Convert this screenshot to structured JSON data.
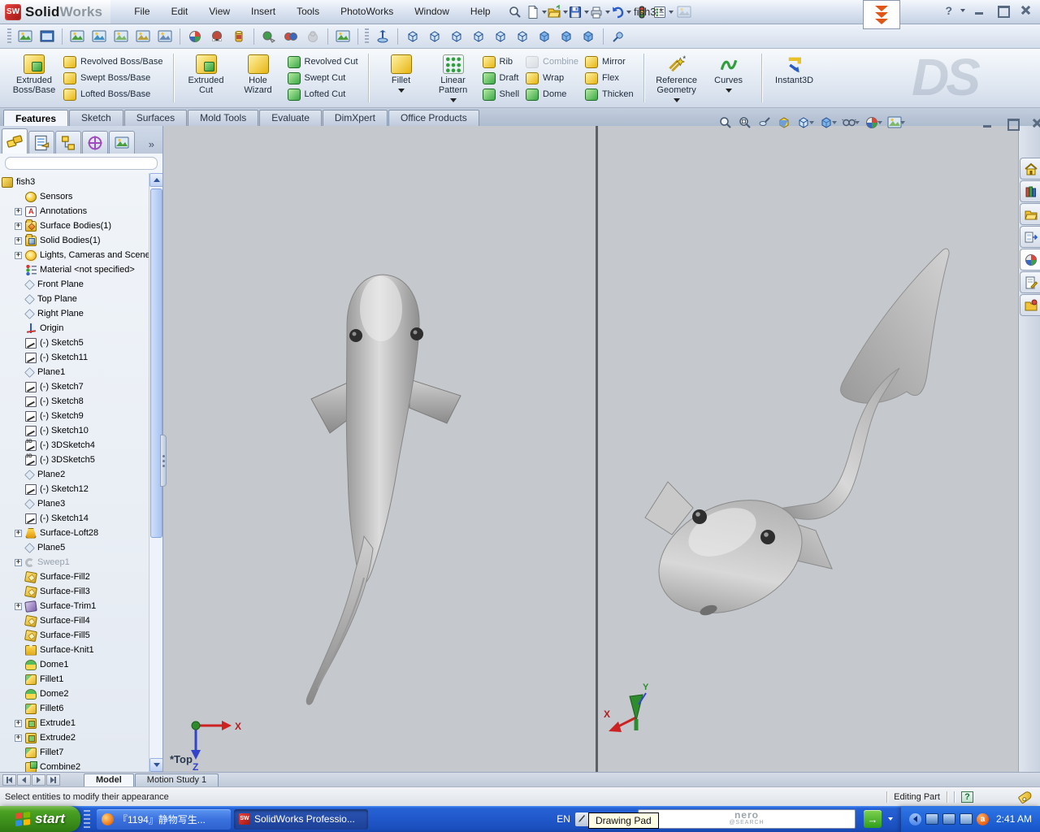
{
  "window": {
    "app_bold": "Solid",
    "app_light": "Works",
    "logo_glyph": "SW",
    "doc_title": "fish3 *",
    "help_glyph": "?"
  },
  "menu": {
    "items": [
      "File",
      "Edit",
      "View",
      "Insert",
      "Tools",
      "PhotoWorks",
      "Window",
      "Help"
    ]
  },
  "toolbar_top": {
    "buttons": [
      {
        "name": "search-assistant"
      },
      {
        "name": "new-document",
        "arrow": true
      },
      {
        "name": "open-document",
        "arrow": true
      },
      {
        "name": "save-document",
        "arrow": true
      },
      {
        "name": "print",
        "arrow": true
      },
      {
        "name": "undo",
        "arrow": true
      },
      {
        "name": "rebuild"
      },
      {
        "name": "options",
        "arrow": true
      },
      {
        "name": "image-disabled",
        "disabled": true
      }
    ]
  },
  "toolbar_photoworks": {
    "buttons": [
      {
        "name": "render"
      },
      {
        "name": "render-window"
      },
      {
        "sep": true
      },
      {
        "name": "render-region"
      },
      {
        "name": "render-selection"
      },
      {
        "name": "render-last"
      },
      {
        "name": "render-to-file"
      },
      {
        "name": "schedule-render"
      },
      {
        "sep": true
      },
      {
        "name": "appearance-sphere"
      },
      {
        "name": "scene-sphere"
      },
      {
        "name": "decal"
      },
      {
        "sep": true
      },
      {
        "name": "copy-appearance"
      },
      {
        "name": "paste-appearance"
      },
      {
        "name": "appearance-locked",
        "disabled": true
      },
      {
        "sep": true
      },
      {
        "name": "scene-editor"
      }
    ]
  },
  "toolbar_views": {
    "buttons": [
      {
        "name": "normal-to"
      },
      {
        "sep": true
      },
      {
        "name": "view-front",
        "wire": true
      },
      {
        "name": "view-back",
        "wire": true
      },
      {
        "name": "view-left",
        "wire": true
      },
      {
        "name": "view-right",
        "wire": true
      },
      {
        "name": "view-top",
        "wire": true
      },
      {
        "name": "view-bottom",
        "wire": true
      },
      {
        "name": "view-isometric"
      },
      {
        "name": "view-trimetric"
      },
      {
        "name": "view-dimetric"
      },
      {
        "sep": true
      },
      {
        "name": "probe"
      }
    ]
  },
  "ribbon": {
    "groups": [
      {
        "cells": [
          {
            "kind": "large",
            "label": "Extruded\nBoss/Base",
            "icon": "extruded-boss",
            "tone": "yg"
          },
          {
            "kind": "stack",
            "items": [
              {
                "label": "Revolved Boss/Base",
                "icon": "revolved-boss",
                "tone": "y"
              },
              {
                "label": "Swept Boss/Base",
                "icon": "swept-boss",
                "tone": "y"
              },
              {
                "label": "Lofted Boss/Base",
                "icon": "lofted-boss",
                "tone": "y"
              }
            ]
          }
        ]
      },
      {
        "cells": [
          {
            "kind": "large",
            "label": "Extruded\nCut",
            "icon": "extruded-cut",
            "tone": "yg"
          },
          {
            "kind": "large",
            "label": "Hole\nWizard",
            "icon": "hole-wizard",
            "tone": "y"
          },
          {
            "kind": "stack",
            "items": [
              {
                "label": "Revolved Cut",
                "icon": "revolved-cut",
                "tone": "g"
              },
              {
                "label": "Swept Cut",
                "icon": "swept-cut",
                "tone": "g"
              },
              {
                "label": "Lofted Cut",
                "icon": "lofted-cut",
                "tone": "g"
              }
            ]
          }
        ]
      },
      {
        "cells": [
          {
            "kind": "large",
            "label": "Fillet",
            "icon": "fillet",
            "tone": "y",
            "arrow": true
          },
          {
            "kind": "large",
            "label": "Linear\nPattern",
            "icon": "linear-pattern",
            "tone": "dots",
            "arrow": true
          },
          {
            "kind": "stack",
            "items": [
              {
                "label": "Rib",
                "icon": "rib",
                "tone": "y"
              },
              {
                "label": "Draft",
                "icon": "draft",
                "tone": "g"
              },
              {
                "label": "Shell",
                "icon": "shell",
                "tone": "g"
              }
            ]
          },
          {
            "kind": "stack",
            "items": [
              {
                "label": "Combine",
                "icon": "combine",
                "tone": "gray",
                "disabled": true
              },
              {
                "label": "Wrap",
                "icon": "wrap",
                "tone": "y"
              },
              {
                "label": "Dome",
                "icon": "dome",
                "tone": "g"
              }
            ]
          },
          {
            "kind": "stack",
            "items": [
              {
                "label": "Mirror",
                "icon": "mirror",
                "tone": "y"
              },
              {
                "label": "Flex",
                "icon": "flex",
                "tone": "y"
              },
              {
                "label": "Thicken",
                "icon": "thicken",
                "tone": "g"
              }
            ]
          }
        ]
      },
      {
        "cells": [
          {
            "kind": "large",
            "label": "Reference\nGeometry",
            "icon": "reference-geometry",
            "tone": "y",
            "arrow": true
          },
          {
            "kind": "large",
            "label": "Curves",
            "icon": "curves",
            "tone": "curves",
            "arrow": true
          }
        ]
      },
      {
        "cells": [
          {
            "kind": "large",
            "label": "Instant3D",
            "icon": "instant3d",
            "tone": "i3d"
          }
        ]
      }
    ],
    "watermark": "DS"
  },
  "cmd_tabs": {
    "items": [
      {
        "label": "Features",
        "active": true
      },
      {
        "label": "Sketch"
      },
      {
        "label": "Surfaces"
      },
      {
        "label": "Mold Tools"
      },
      {
        "label": "Evaluate"
      },
      {
        "label": "DimXpert"
      },
      {
        "label": "Office Products"
      }
    ]
  },
  "panel": {
    "tabs": [
      "feature-manager-tree",
      "property-manager",
      "configuration-manager",
      "dimxpert-manager",
      "display-manager"
    ],
    "overflow_glyph": "»"
  },
  "tree": {
    "items": [
      {
        "label": "fish3",
        "shape": "part",
        "root": true
      },
      {
        "label": "Sensors",
        "shape": "sensor"
      },
      {
        "label": "Annotations",
        "shape": "ann",
        "plus": true
      },
      {
        "label": "Surface Bodies(1)",
        "shape": "folder-surface",
        "plus": true
      },
      {
        "label": "Solid Bodies(1)",
        "shape": "folder-solid",
        "plus": true
      },
      {
        "label": "Lights, Cameras and Scene",
        "shape": "light",
        "plus": true
      },
      {
        "label": "Material <not specified>",
        "shape": "mat"
      },
      {
        "label": "Front Plane",
        "shape": "plane"
      },
      {
        "label": "Top Plane",
        "shape": "plane"
      },
      {
        "label": "Right Plane",
        "shape": "plane"
      },
      {
        "label": "Origin",
        "shape": "origin"
      },
      {
        "label": "(-) Sketch5",
        "shape": "sketch"
      },
      {
        "label": "(-) Sketch11",
        "shape": "sketch"
      },
      {
        "label": "Plane1",
        "shape": "plane"
      },
      {
        "label": "(-) Sketch7",
        "shape": "sketch"
      },
      {
        "label": "(-) Sketch8",
        "shape": "sketch"
      },
      {
        "label": "(-) Sketch9",
        "shape": "sketch"
      },
      {
        "label": "(-) Sketch10",
        "shape": "sketch"
      },
      {
        "label": "(-) 3DSketch4",
        "shape": "sk3d"
      },
      {
        "label": "(-) 3DSketch5",
        "shape": "sk3d"
      },
      {
        "label": "Plane2",
        "shape": "plane"
      },
      {
        "label": "(-) Sketch12",
        "shape": "sketch"
      },
      {
        "label": "Plane3",
        "shape": "plane"
      },
      {
        "label": "(-) Sketch14",
        "shape": "sketch"
      },
      {
        "label": "Surface-Loft28",
        "shape": "loft",
        "plus": true
      },
      {
        "label": "Plane5",
        "shape": "plane"
      },
      {
        "label": "Sweep1",
        "shape": "sweep",
        "plus": true,
        "gray": true
      },
      {
        "label": "Surface-Fill2",
        "shape": "fill"
      },
      {
        "label": "Surface-Fill3",
        "shape": "fill"
      },
      {
        "label": "Surface-Trim1",
        "shape": "trim",
        "plus": true
      },
      {
        "label": "Surface-Fill4",
        "shape": "fill"
      },
      {
        "label": "Surface-Fill5",
        "shape": "fill"
      },
      {
        "label": "Surface-Knit1",
        "shape": "knit"
      },
      {
        "label": "Dome1",
        "shape": "dome"
      },
      {
        "label": "Fillet1",
        "shape": "fillet"
      },
      {
        "label": "Dome2",
        "shape": "dome"
      },
      {
        "label": "Fillet6",
        "shape": "fillet"
      },
      {
        "label": "Extrude1",
        "shape": "extrude",
        "plus": true
      },
      {
        "label": "Extrude2",
        "shape": "extrude",
        "plus": true
      },
      {
        "label": "Fillet7",
        "shape": "fillet"
      },
      {
        "label": "Combine2",
        "shape": "combine"
      }
    ]
  },
  "viewport": {
    "left_label": "*Top",
    "axis_x": "X",
    "axis_z": "Z",
    "axis_y": "Y",
    "headsup": [
      {
        "name": "zoom-to-fit"
      },
      {
        "name": "zoom-to-area"
      },
      {
        "name": "magnifying-lens"
      },
      {
        "name": "section-view"
      },
      {
        "name": "view-orientation",
        "arrow": true
      },
      {
        "name": "display-style",
        "arrow": true
      },
      {
        "name": "hide-show-items",
        "arrow": true
      },
      {
        "name": "edit-appearance",
        "arrow": true
      },
      {
        "name": "apply-scene",
        "arrow": true
      }
    ]
  },
  "taskpane": {
    "tabs": [
      "solidworks-resources",
      "design-library",
      "file-explorer",
      "view-palette",
      "appearances-scenes",
      "custom-properties",
      "document-recovery"
    ]
  },
  "sheet": {
    "tabs": [
      {
        "label": "Model",
        "active": true
      },
      {
        "label": "Motion Study 1"
      }
    ]
  },
  "status": {
    "message": "Select entities to modify their appearance",
    "mode": "Editing Part"
  },
  "taskbar": {
    "start_label": "start",
    "tasks": [
      {
        "label": "『1194』静物写生...",
        "icon": "firefox"
      },
      {
        "label": "SolidWorks Professio...",
        "icon": "solidworks",
        "active": true
      }
    ],
    "lang": "EN",
    "tooltip": "Drawing Pad",
    "search_line1": "nero",
    "search_line2": "@SEARCH",
    "clock": "2:41 AM"
  }
}
